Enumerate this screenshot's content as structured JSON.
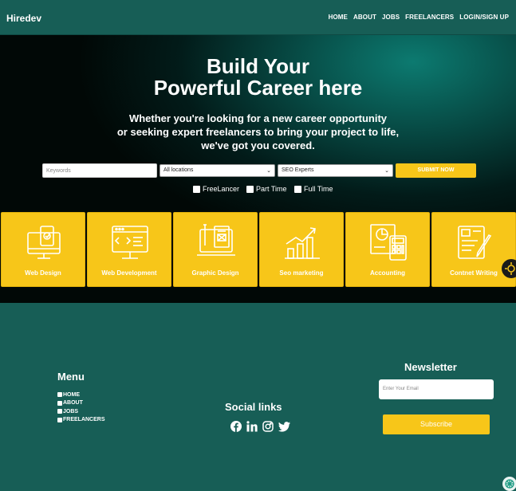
{
  "nav": {
    "logo": "Hiredev",
    "links": [
      "HOME",
      "ABOUT",
      "JOBS",
      "FREELANCERS",
      "LOGIN/SIGN UP"
    ]
  },
  "hero": {
    "title_line1": "Build Your",
    "title_line2": "Powerful Career here",
    "sub_line1": "Whether you're looking for a new career opportunity",
    "sub_line2": "or seeking expert freelancers to bring your project to life,",
    "sub_line3": "we've got you covered."
  },
  "search": {
    "keyword_placeholder": "Keywords",
    "location_selected": "All locations",
    "category_selected": "SEO Experts",
    "submit_label": "SUBMIT NOW"
  },
  "filters": [
    "FreeLancer",
    "Part Time",
    "Full Time"
  ],
  "categories": [
    "Web Design",
    "Web Development",
    "Graphic Design",
    "Seo marketing",
    "Accounting",
    "Contnet Writing"
  ],
  "footer": {
    "menu_title": "Menu",
    "menu_items": [
      "HOME",
      "ABOUT",
      "JOBS",
      "FREELANCERS"
    ],
    "social_title": "Social links",
    "social_icons": [
      "facebook-icon",
      "linkedin-icon",
      "instagram-icon",
      "twitter-icon"
    ],
    "newsletter_title": "Newsletter",
    "email_placeholder": "Enter Your Email",
    "subscribe_label": "Subscribe"
  },
  "colors": {
    "primary": "#175e56",
    "accent": "#f7c619"
  }
}
